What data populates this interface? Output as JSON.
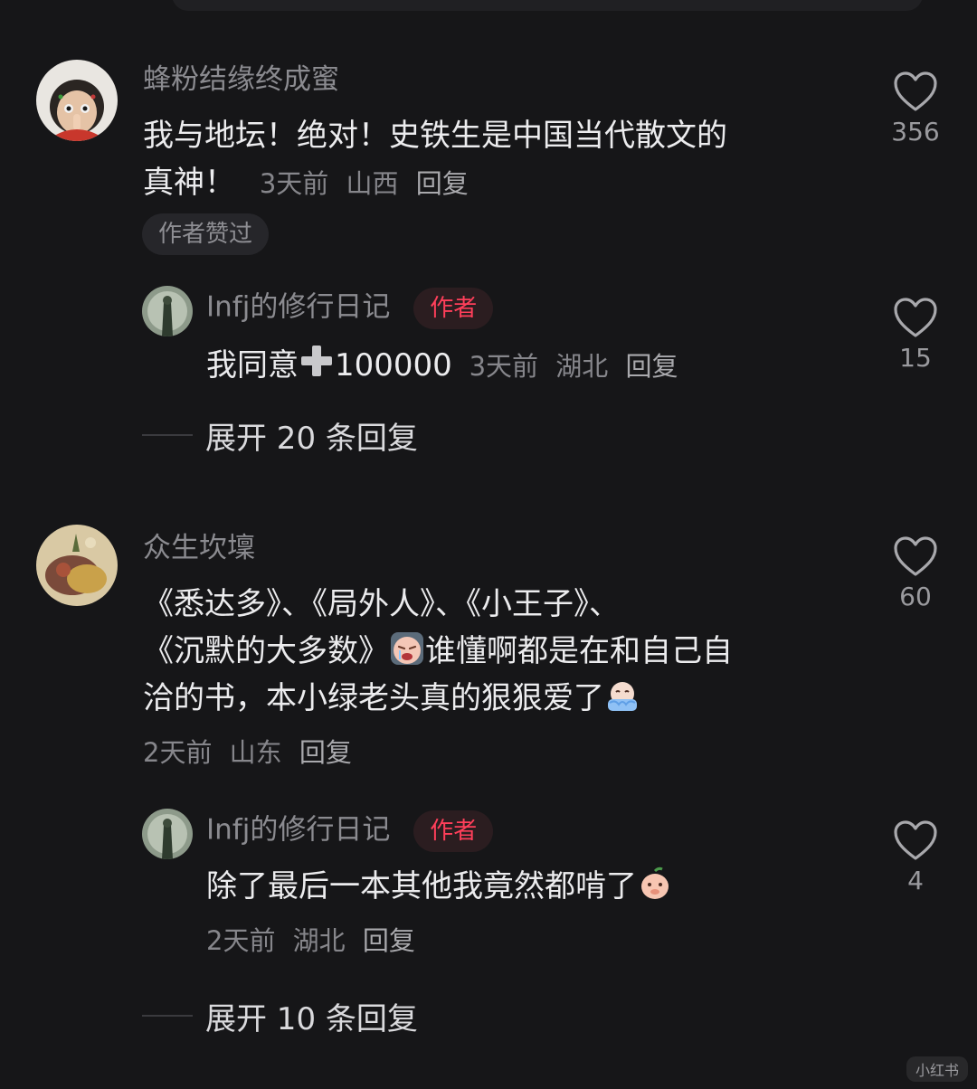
{
  "comments": [
    {
      "user": "蜂粉结缘终成蜜",
      "text_line1": "我与地坛！绝对！史铁生是中国当代散文的",
      "text_line2": "真神！",
      "time": "3天前",
      "location": "山西",
      "reply": "回复",
      "liked_badge": "作者赞过",
      "likes": "356",
      "replies": [
        {
          "user": "Infj的修行日记",
          "author_badge": "作者",
          "text": "我同意",
          "plus_icon": "heavy-plus-emoji",
          "text_suffix": "100000",
          "time": "3天前",
          "location": "湖北",
          "reply": "回复",
          "likes": "15"
        }
      ],
      "expand_label": "展开 20 条回复"
    },
    {
      "user": "众生坎壈",
      "text_line1": "《悉达多》、《局外人》、《小王子》、",
      "text_line2a": "《沉默的大多数》",
      "text_line2b": "谁懂啊都是在和自己自",
      "text_line3": "洽的书，本小绿老头真的狠狠爱了",
      "emoji1": "crying-face-emoji",
      "emoji2": "touched-crying-emoji",
      "time": "2天前",
      "location": "山东",
      "reply": "回复",
      "likes": "60",
      "replies": [
        {
          "user": "Infj的修行日记",
          "author_badge": "作者",
          "text": "除了最后一本其他我竟然都啃了",
          "emoji": "peach-shy-emoji",
          "time": "2天前",
          "location": "湖北",
          "reply": "回复",
          "likes": "4"
        }
      ],
      "expand_label": "展开 10 条回复"
    }
  ],
  "icons": {
    "like": "heart-outline-icon"
  },
  "colors": {
    "background": "#161618",
    "author_badge": "#ff3f5a"
  },
  "watermark": "小红书"
}
